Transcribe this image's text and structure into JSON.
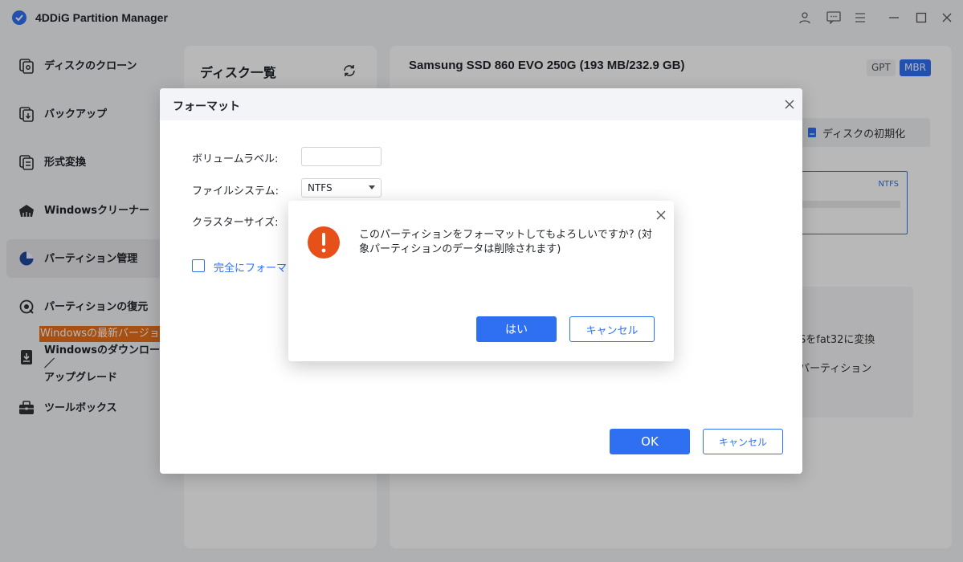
{
  "app": {
    "title": "4DDiG Partition Manager",
    "accent_color": "#2f6ff2",
    "window_controls": [
      "user-icon",
      "feedback-icon",
      "menu-icon",
      "minimize-icon",
      "maximize-icon",
      "close-icon"
    ]
  },
  "sidebar": {
    "items": [
      {
        "label": "ディスクのクローン",
        "icon": "disk-clone-icon"
      },
      {
        "label": "バックアップ",
        "icon": "backup-icon"
      },
      {
        "label": "形式変換",
        "icon": "convert-icon"
      },
      {
        "label": "Windowsクリーナー",
        "icon": "cleaner-icon"
      },
      {
        "label": "パーティション管理",
        "icon": "partition-icon",
        "active": true
      },
      {
        "label": "パーティションの復元",
        "icon": "restore-icon"
      },
      {
        "label": "Windowsのダウンロード／アップグレード",
        "label_line1": "Windowsのダウンロード／",
        "label_line2": "アップグレード",
        "icon": "windows-download-icon"
      },
      {
        "label": "ツールボックス",
        "icon": "toolbox-icon"
      }
    ],
    "promo": "Windowsの最新バージョ"
  },
  "disk_list": {
    "title": "ディスク一覧"
  },
  "disk_detail": {
    "title": "Samsung SSD 860 EVO 250G (193 MB/232.9 GB)",
    "gpt_label": "GPT",
    "mbr_label": "MBR",
    "init_tab": "ディスクの初期化",
    "partition_fs": "NTFS",
    "func_text_1": "Sをfat32に変換",
    "func_text_2": "パーティション"
  },
  "format_dialog": {
    "title": "フォーマット",
    "volume_label": "ボリュームラベル:",
    "volume_value": "",
    "filesystem_label": "ファイルシステム:",
    "filesystem_value": "NTFS",
    "cluster_label": "クラスターサイズ:",
    "full_format_label": "完全にフォーマッ",
    "ok_label": "OK",
    "cancel_label": "キャンセル"
  },
  "confirm_dialog": {
    "message": "このパーティションをフォーマットしてもよろしいですか？(対象パーティションのデータは削除されます)",
    "message_line1": "このパーティションをフォーマットしてもよろしいですか? (対",
    "message_line2": "象パーティションのデータは削除されます)",
    "yes_label": "はい",
    "cancel_label": "キャンセル",
    "icon": "warning-icon",
    "icon_color": "#e8501a"
  }
}
